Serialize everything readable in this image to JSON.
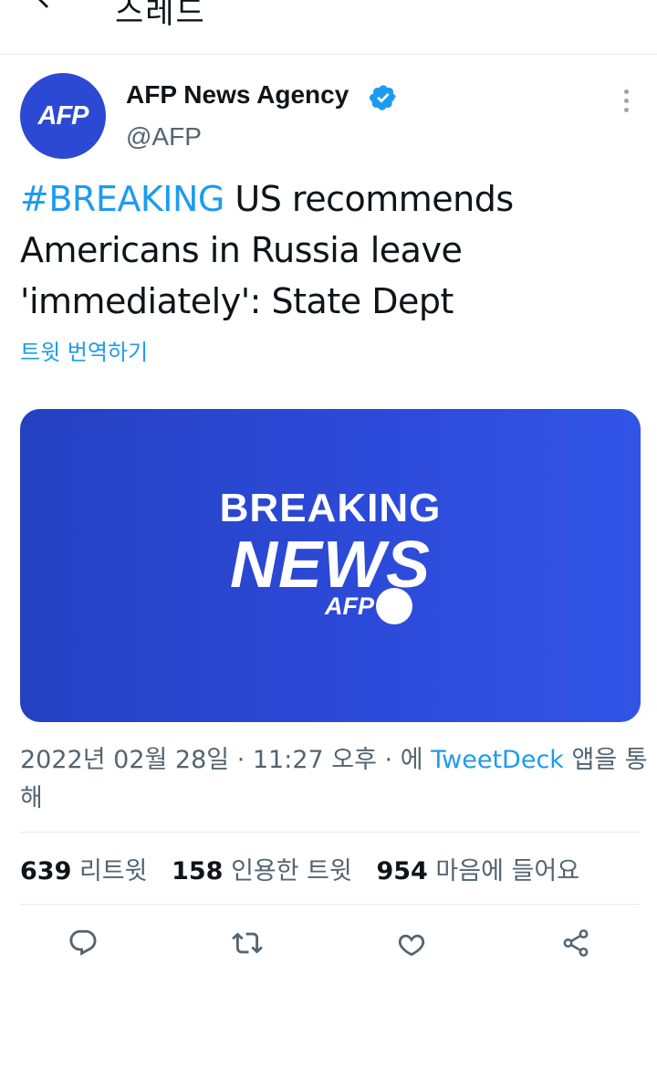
{
  "topbar": {
    "title": "스레드"
  },
  "tweet": {
    "author_name": "AFP News Agency",
    "author_handle": "@AFP",
    "avatar_text": "AFP",
    "hashtag": "#BREAKING",
    "text": " US recommends Americans in Russia leave 'immediately': State Dept",
    "translate_label": "트윗 번역하기",
    "media": {
      "line1": "BREAKING",
      "line2": "NEWS",
      "logo": "AFP"
    },
    "date": "2022년 02월 28일",
    "sep1": " · ",
    "time": "11:27 오후",
    "sep2": " · 에 ",
    "source": "TweetDeck",
    "via_suffix": " 앱을 통해"
  },
  "stats": {
    "retweets_count": "639",
    "retweets_label": "리트윗",
    "quotes_count": "158",
    "quotes_label": "인용한 트윗",
    "likes_count": "954",
    "likes_label": "마음에 들어요"
  },
  "colors": {
    "accent": "#1d9bf0",
    "media_blue": "#2c49d3",
    "secondary_text": "#536471",
    "icon_gray": "#536471"
  }
}
